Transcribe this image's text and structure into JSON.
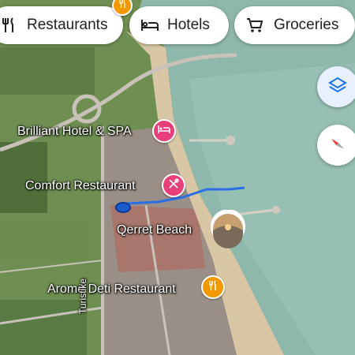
{
  "filters": {
    "restaurants": {
      "label": "Restaurants",
      "icon": "restaurant-icon"
    },
    "hotels": {
      "label": "Hotels",
      "icon": "hotel-icon"
    },
    "groceries": {
      "label": "Groceries",
      "icon": "shopping-cart-icon"
    }
  },
  "controls": {
    "layers": {
      "icon": "layers-icon"
    },
    "compass": {
      "icon": "compass-icon"
    }
  },
  "places": {
    "brilliant_hotel": {
      "label": "Brilliant Hotel & SPA",
      "icon": "hotel-icon"
    },
    "comfort_restaurant": {
      "label": "Comfort Restaurant",
      "icon": "restaurant-icon"
    },
    "qerret_beach": {
      "label": "Qerret Beach",
      "icon": "photo-icon"
    },
    "arome_deti": {
      "label": "Aromë Deti Restaurant",
      "icon": "restaurant-icon"
    },
    "top_restaurant": {
      "label": "",
      "icon": "restaurant-icon"
    }
  },
  "roads": {
    "partial_label": "Turistike"
  },
  "colors": {
    "sea": "#8fb8ad",
    "land": "#6f8f52",
    "beach": "#d8c6a4",
    "hotel_pin": "#e8407a",
    "restaurant_pin": "#f29900",
    "route": "#2a6fe8",
    "location_dot": "#1a5ccc"
  }
}
